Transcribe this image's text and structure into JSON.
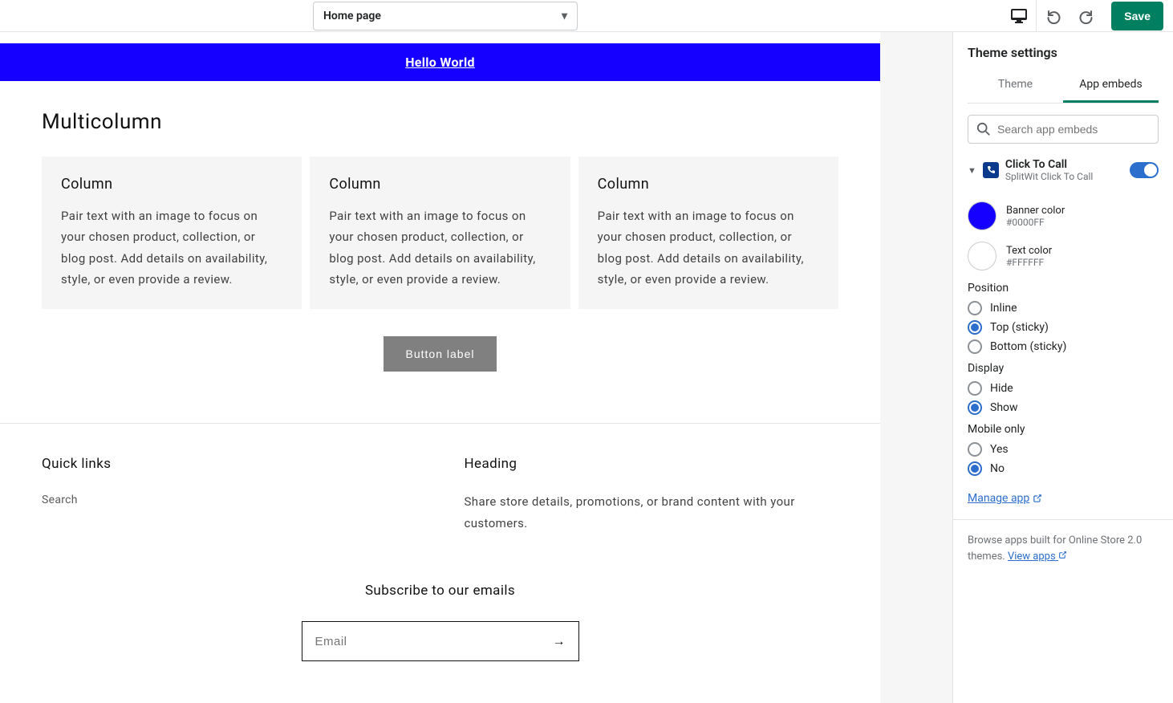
{
  "topbar": {
    "page_select": "Home page",
    "save": "Save"
  },
  "preview": {
    "banner_text": "Hello World",
    "multicolumn": {
      "title": "Multicolumn",
      "columns": [
        {
          "title": "Column",
          "body": "Pair text with an image to focus on your chosen product, collection, or blog post. Add details on availability, style, or even provide a review."
        },
        {
          "title": "Column",
          "body": "Pair text with an image to focus on your chosen product, collection, or blog post. Add details on availability, style, or even provide a review."
        },
        {
          "title": "Column",
          "body": "Pair text with an image to focus on your chosen product, collection, or blog post. Add details on availability, style, or even provide a review."
        }
      ],
      "button": "Button label"
    },
    "footer": {
      "quick_links_title": "Quick links",
      "quick_links": {
        "search": "Search"
      },
      "heading_title": "Heading",
      "heading_body": "Share store details, promotions, or brand content with your customers.",
      "subscribe_title": "Subscribe to our emails",
      "email_placeholder": "Email"
    }
  },
  "sidebar": {
    "title": "Theme settings",
    "tabs": {
      "theme": "Theme",
      "app_embeds": "App embeds"
    },
    "search_placeholder": "Search app embeds",
    "embed": {
      "name": "Click To Call",
      "subtitle": "SplitWit Click To Call",
      "banner_color": {
        "label": "Banner color",
        "value": "#0000FF"
      },
      "text_color": {
        "label": "Text color",
        "value": "#FFFFFF"
      },
      "position": {
        "label": "Position",
        "options": {
          "inline": "Inline",
          "top": "Top (sticky)",
          "bottom": "Bottom (sticky)"
        }
      },
      "display": {
        "label": "Display",
        "options": {
          "hide": "Hide",
          "show": "Show"
        }
      },
      "mobile": {
        "label": "Mobile only",
        "options": {
          "yes": "Yes",
          "no": "No"
        }
      },
      "manage": "Manage app"
    },
    "browse_text": "Browse apps built for Online Store 2.0 themes. ",
    "view_apps": "View apps"
  }
}
